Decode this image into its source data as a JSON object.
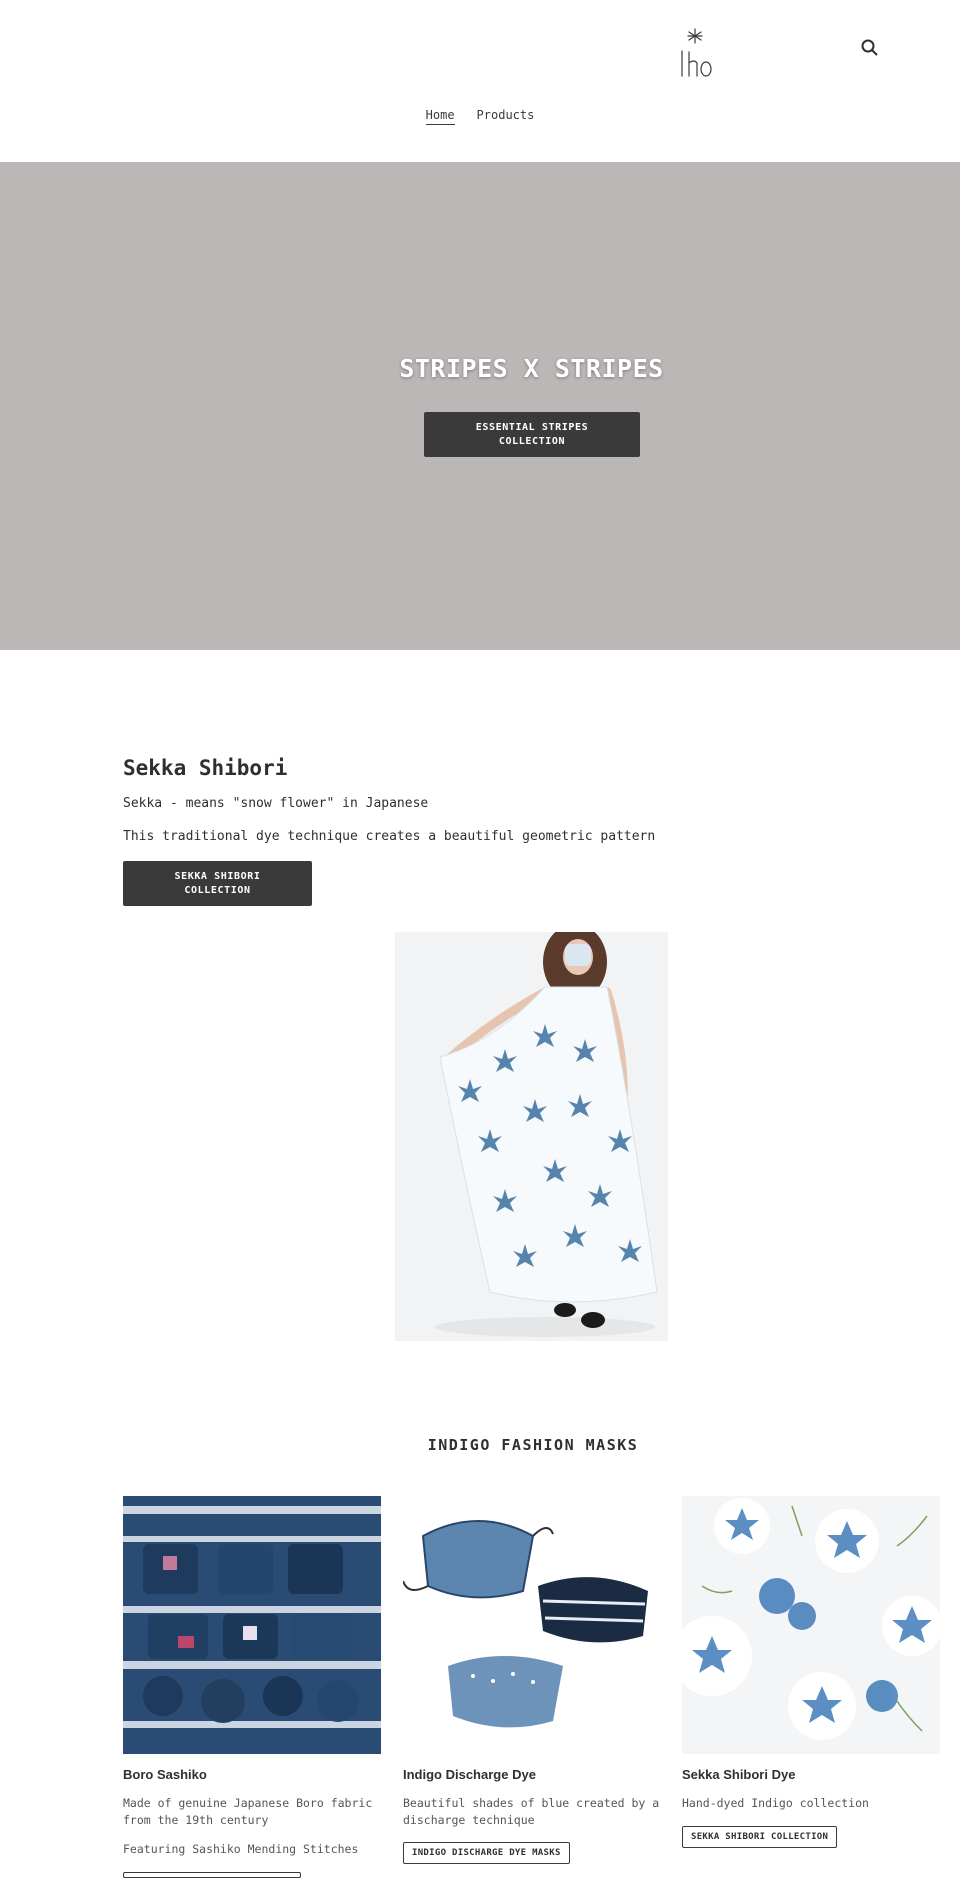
{
  "header": {
    "nav": [
      {
        "label": "Home"
      },
      {
        "label": "Products"
      }
    ]
  },
  "hero": {
    "title": "STRIPES X STRIPES",
    "button_label": "ESSENTIAL STRIPES COLLECTION"
  },
  "sekka": {
    "title": "Sekka Shibori",
    "subtitle": "Sekka - means \"snow flower\" in Japanese",
    "description": "This traditional dye technique creates a beautiful geometric pattern",
    "button_label": "SEKKA SHIBORI COLLECTION"
  },
  "masks": {
    "title": "INDIGO FASHION MASKS",
    "cards": [
      {
        "title": "Boro Sashiko",
        "description": "Made of genuine Japanese Boro fabric from the 19th century",
        "feature": "Featuring Sashiko Mending Stitches",
        "button_label": ""
      },
      {
        "title": "Indigo Discharge Dye",
        "description": "Beautiful shades of blue created by a discharge technique",
        "feature": "",
        "button_label": "INDIGO DISCHARGE DYE MASKS"
      },
      {
        "title": "Sekka Shibori Dye",
        "description": "Hand-dyed Indigo collection",
        "feature": "",
        "button_label": "SEKKA SHIBORI COLLECTION"
      }
    ]
  },
  "icons": {
    "logo": "lho-logo",
    "search": "search-icon"
  },
  "colors": {
    "hero_bg": "#bcb7b7",
    "button_dark": "#3a3a3a",
    "text": "#3a3a3a",
    "indigo": "#1f4a7a"
  }
}
